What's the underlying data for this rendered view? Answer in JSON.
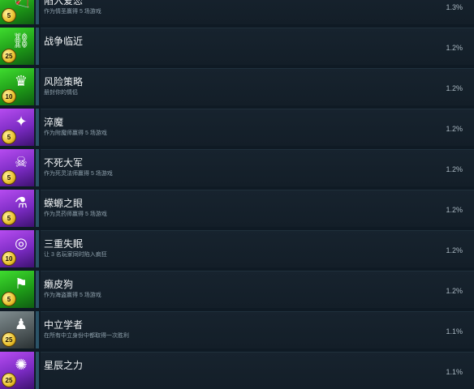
{
  "achievements": [
    {
      "title": "陷入爱恋",
      "desc": "作为情圣赢得 5 场游戏",
      "pct": "1.3%",
      "badge": "5",
      "theme": "green",
      "icon": "cupid-arrow-icon",
      "glyph": "🏹"
    },
    {
      "title": "战争临近",
      "desc": "",
      "pct": "1.2%",
      "badge": "25",
      "theme": "green",
      "icon": "chain-icon",
      "glyph": "⛓"
    },
    {
      "title": "风险策略",
      "desc": "册封你的情侣",
      "pct": "1.2%",
      "badge": "10",
      "theme": "green",
      "icon": "crown-icon",
      "glyph": "♛"
    },
    {
      "title": "淬魔",
      "desc": "作为附魔师赢得 5 场游戏",
      "pct": "1.2%",
      "badge": "5",
      "theme": "purple",
      "icon": "origami-crane-icon",
      "glyph": "✦"
    },
    {
      "title": "不死大军",
      "desc": "作为死灵法师赢得 5 场游戏",
      "pct": "1.2%",
      "badge": "5",
      "theme": "purple",
      "icon": "undead-figure-icon",
      "glyph": "☠"
    },
    {
      "title": "蝾螈之眼",
      "desc": "作为灵药师赢得 5 场游戏",
      "pct": "1.2%",
      "badge": "5",
      "theme": "purple",
      "icon": "potion-flask-icon",
      "glyph": "⚗"
    },
    {
      "title": "三重失眠",
      "desc": "让 3 名玩家同时陷入疯狂",
      "pct": "1.2%",
      "badge": "10",
      "theme": "purple",
      "icon": "dreamcatcher-icon",
      "glyph": "◎"
    },
    {
      "title": "癞皮狗",
      "desc": "作为海盗赢得 5 场游戏",
      "pct": "1.2%",
      "badge": "5",
      "theme": "green",
      "icon": "pirate-flag-icon",
      "glyph": "⚑"
    },
    {
      "title": "中立学者",
      "desc": "在所有中立身份中都取得一次胜利",
      "pct": "1.1%",
      "badge": "25",
      "theme": "grey",
      "icon": "chess-pawn-icon",
      "glyph": "♟"
    },
    {
      "title": "星辰之力",
      "desc": "",
      "pct": "1.1%",
      "badge": "25",
      "theme": "purple",
      "icon": "star-creature-icon",
      "glyph": "✺"
    }
  ]
}
